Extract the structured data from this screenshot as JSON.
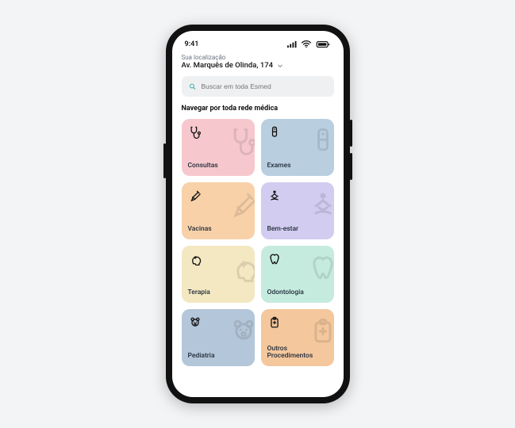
{
  "status": {
    "time": "9:41"
  },
  "location": {
    "label": "Sua localização",
    "value": "Av. Marquês de Olinda, 174"
  },
  "search": {
    "placeholder": "Buscar em toda Esmed"
  },
  "section": {
    "title": "Navegar por toda rede médica"
  },
  "cards": [
    {
      "label": "Consultas",
      "icon": "stethoscope",
      "color": "c-pink"
    },
    {
      "label": "Exames",
      "icon": "vial",
      "color": "c-blue"
    },
    {
      "label": "Vacinas",
      "icon": "syringe",
      "color": "c-orange"
    },
    {
      "label": "Bem-estar",
      "icon": "meditation",
      "color": "c-violet"
    },
    {
      "label": "Terapia",
      "icon": "head",
      "color": "c-cream"
    },
    {
      "label": "Odontologia",
      "icon": "tooth",
      "color": "c-mint"
    },
    {
      "label": "Pediatria",
      "icon": "teddy",
      "color": "c-slate"
    },
    {
      "label": "Outros\nProcedimentos",
      "icon": "clipboard",
      "color": "c-peach"
    }
  ]
}
